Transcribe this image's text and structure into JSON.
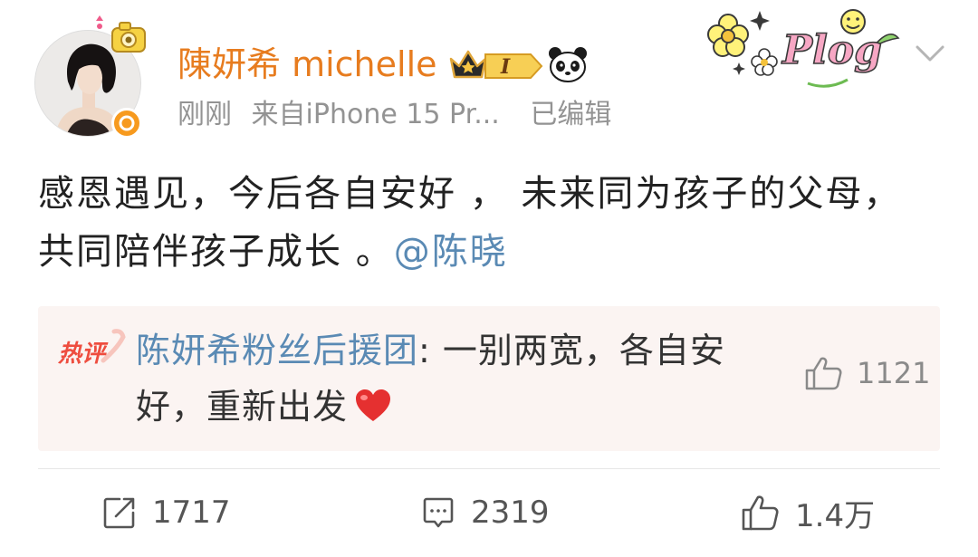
{
  "post": {
    "user": {
      "name": "陳妍希 michelle",
      "level": "I",
      "verified_color": "#f79a1e"
    },
    "meta": {
      "time": "刚刚",
      "source": "来自iPhone 15 Pr...",
      "edited": "已编辑"
    },
    "sticker_text": "Plog",
    "text": "感恩遇见，今后各自安好 ， 未来同为孩子的父母， 共同陪伴孩子成长 。",
    "mention": "@陈晓",
    "hot_comment": {
      "tag": "热评",
      "author": "陈妍希粉丝后援团",
      "separator": ": ",
      "text": "一别两宽，各自安好，重新出发",
      "emoji": "heart",
      "likes": "1121"
    },
    "actions": {
      "reposts": "1717",
      "comments": "2319",
      "likes": "1.4万"
    },
    "colors": {
      "username": "#e77c1f",
      "link": "#5a8ab4",
      "hot_tag": "#ee4d3f",
      "comment_bg": "#fbf4f2",
      "meta": "#939393"
    },
    "icons": [
      "camera-pendant-icon",
      "crown-icon",
      "panda-icon",
      "chevron-down-icon",
      "thumbs-up-icon",
      "repost-icon",
      "comment-icon",
      "heart-icon"
    ]
  }
}
